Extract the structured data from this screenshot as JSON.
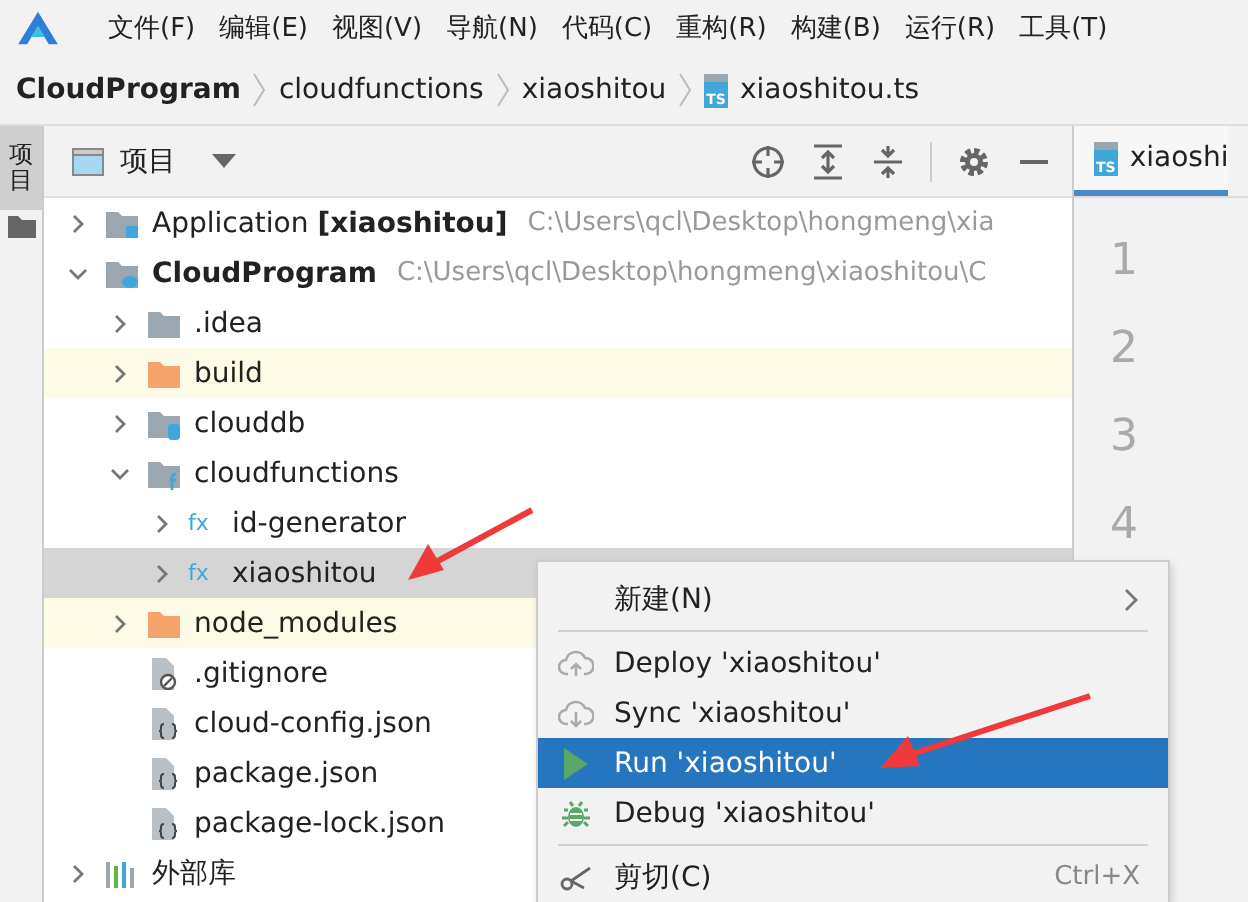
{
  "menu_bar": {
    "items": [
      "文件(F)",
      "编辑(E)",
      "视图(V)",
      "导航(N)",
      "代码(C)",
      "重构(R)",
      "构建(B)",
      "运行(R)",
      "工具(T)"
    ]
  },
  "breadcrumb": {
    "items": [
      {
        "label": "CloudProgram",
        "kind": "module"
      },
      {
        "label": "cloudfunctions",
        "kind": "folder"
      },
      {
        "label": "xiaoshitou",
        "kind": "folder"
      },
      {
        "label": "xiaoshitou.ts",
        "kind": "file",
        "badge": "TS"
      }
    ]
  },
  "side_strip": {
    "tabs": [
      {
        "label": "项目",
        "selected": true
      }
    ]
  },
  "project_panel": {
    "title": "项目",
    "tree": [
      {
        "label": "Application **[xiaoshitou]**",
        "path": "C:\\Users\\qcl\\Desktop\\hongmeng\\xia",
        "kind": "module",
        "expanded": false,
        "selected": false,
        "ignored": false
      },
      {
        "label": "CloudProgram",
        "path": "C:\\Users\\qcl\\Desktop\\hongmeng\\xiaoshitou\\C",
        "kind": "cloudmodule",
        "expanded": true,
        "selected": false,
        "ignored": false,
        "children": [
          {
            "label": ".idea",
            "kind": "folder",
            "expanded": false,
            "selected": false,
            "ignored": false
          },
          {
            "label": "build",
            "kind": "excludedfolder",
            "expanded": false,
            "selected": false,
            "ignored": true
          },
          {
            "label": "clouddb",
            "kind": "dbfolder",
            "expanded": false,
            "selected": false,
            "ignored": false
          },
          {
            "label": "cloudfunctions",
            "kind": "functionsfolder",
            "expanded": true,
            "selected": false,
            "ignored": false,
            "children": [
              {
                "label": "id-generator",
                "kind": "function",
                "icon_text": "fx",
                "expanded": false,
                "selected": false,
                "ignored": false
              },
              {
                "label": "xiaoshitou",
                "kind": "function",
                "icon_text": "fx",
                "expanded": false,
                "selected": true,
                "ignored": false
              }
            ]
          },
          {
            "label": "node_modules",
            "kind": "excludedfolder",
            "expanded": false,
            "selected": false,
            "ignored": true
          },
          {
            "label": ".gitignore",
            "kind": "ignorefile",
            "selected": false,
            "ignored": false
          },
          {
            "label": "cloud-config.json",
            "kind": "jsonfile",
            "selected": false,
            "ignored": false
          },
          {
            "label": "package.json",
            "kind": "jsonfile",
            "selected": false,
            "ignored": false
          },
          {
            "label": "package-lock.json",
            "kind": "jsonfile",
            "selected": false,
            "ignored": false
          }
        ]
      },
      {
        "label": "外部库",
        "kind": "library",
        "expanded": false,
        "selected": false,
        "ignored": false
      }
    ]
  },
  "editor": {
    "tabs": [
      {
        "label": "xiaoshi",
        "badge": "TS",
        "selected": true
      }
    ],
    "line_numbers": [
      "1",
      "2",
      "3",
      "4"
    ]
  },
  "context_menu": {
    "items": [
      {
        "kind": "submenu",
        "label": "新建(N)",
        "selected": false
      },
      {
        "kind": "separator"
      },
      {
        "kind": "deploy",
        "label": "Deploy 'xiaoshitou'",
        "selected": false
      },
      {
        "kind": "sync",
        "label": "Sync 'xiaoshitou'",
        "selected": false
      },
      {
        "kind": "run",
        "label": "Run 'xiaoshitou'",
        "selected": true
      },
      {
        "kind": "debug",
        "label": "Debug 'xiaoshitou'",
        "selected": false
      },
      {
        "kind": "separator"
      },
      {
        "kind": "cut",
        "label": "剪切(C)",
        "shortcut": "Ctrl+X",
        "selected": false
      }
    ]
  },
  "annotations": [
    {
      "kind": "arrow"
    },
    {
      "kind": "arrow"
    }
  ]
}
